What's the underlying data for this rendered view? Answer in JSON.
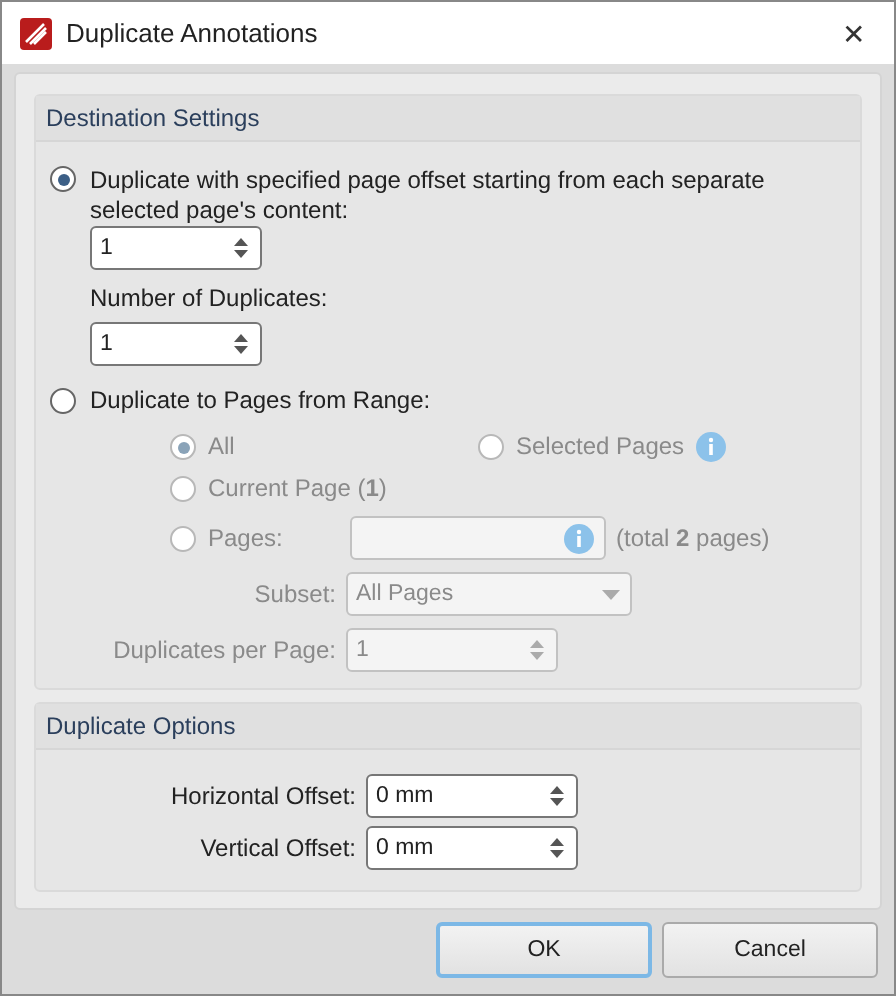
{
  "window": {
    "title": "Duplicate Annotations",
    "close": "✕"
  },
  "destination": {
    "title": "Destination Settings",
    "offset_option": {
      "label": "Duplicate with specified page offset starting from each separate selected page's content:",
      "selected": true
    },
    "offset_value": "1",
    "duplicates_label": "Number of Duplicates:",
    "duplicates_value": "1",
    "range_option": {
      "label": "Duplicate to Pages from Range:",
      "selected": false
    },
    "range": {
      "all": {
        "label": "All",
        "selected": true,
        "disabled": true
      },
      "selected_pages": {
        "label": "Selected Pages",
        "selected": false,
        "disabled": true
      },
      "current_page": {
        "label": "Current Page (**1**)",
        "selected": false,
        "disabled": true
      },
      "pages": {
        "label": "Pages:",
        "selected": false,
        "disabled": true
      },
      "total": "(total **2** pages)",
      "subset_label": "Subset:",
      "subset_value": "All Pages",
      "per_page_label": "Duplicates per Page:",
      "per_page_value": "1"
    }
  },
  "options": {
    "title": "Duplicate Options",
    "fields": [
      {
        "label": "Horizontal Offset:",
        "value": "0 mm"
      },
      {
        "label": "Vertical Offset:",
        "value": "0 mm"
      }
    ]
  },
  "buttons": [
    {
      "label": "OK",
      "default": true
    },
    {
      "label": "Cancel",
      "default": false
    }
  ]
}
